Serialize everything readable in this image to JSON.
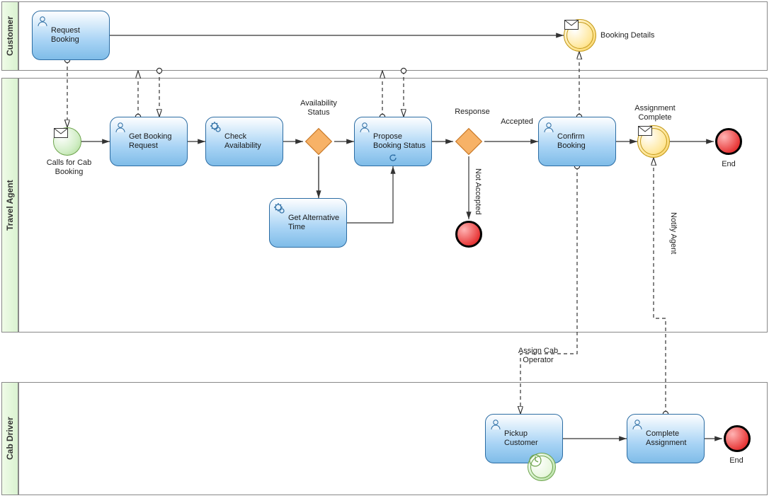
{
  "lanes": {
    "customer": "Customer",
    "agent": "Travel Agent",
    "driver": "Cab Driver"
  },
  "tasks": {
    "requestBooking": "Request Booking",
    "getBookingRequest": "Get Booking Request",
    "checkAvailability": "Check Availability",
    "proposeBookingStatus": "Propose Booking Status",
    "getAlternativeTime": "Get Alternative Time",
    "confirmBooking": "Confirm Booking",
    "pickupCustomer": "Pickup Customer",
    "completeAssignment": "Complete Assignment"
  },
  "events": {
    "callsForCabBooking": "Calls for Cab Booking",
    "bookingDetails": "Booking Details",
    "assignmentComplete": "Assignment Complete",
    "end1": "End",
    "end2": "End"
  },
  "gateways": {
    "availabilityStatus": "Availability Status",
    "response": "Response"
  },
  "flows": {
    "accepted": "Accepted",
    "notAccepted": "Not Accepted",
    "assignCabOperator": "Assign Cab Operator",
    "notifyAgent": "Notify Agent"
  }
}
